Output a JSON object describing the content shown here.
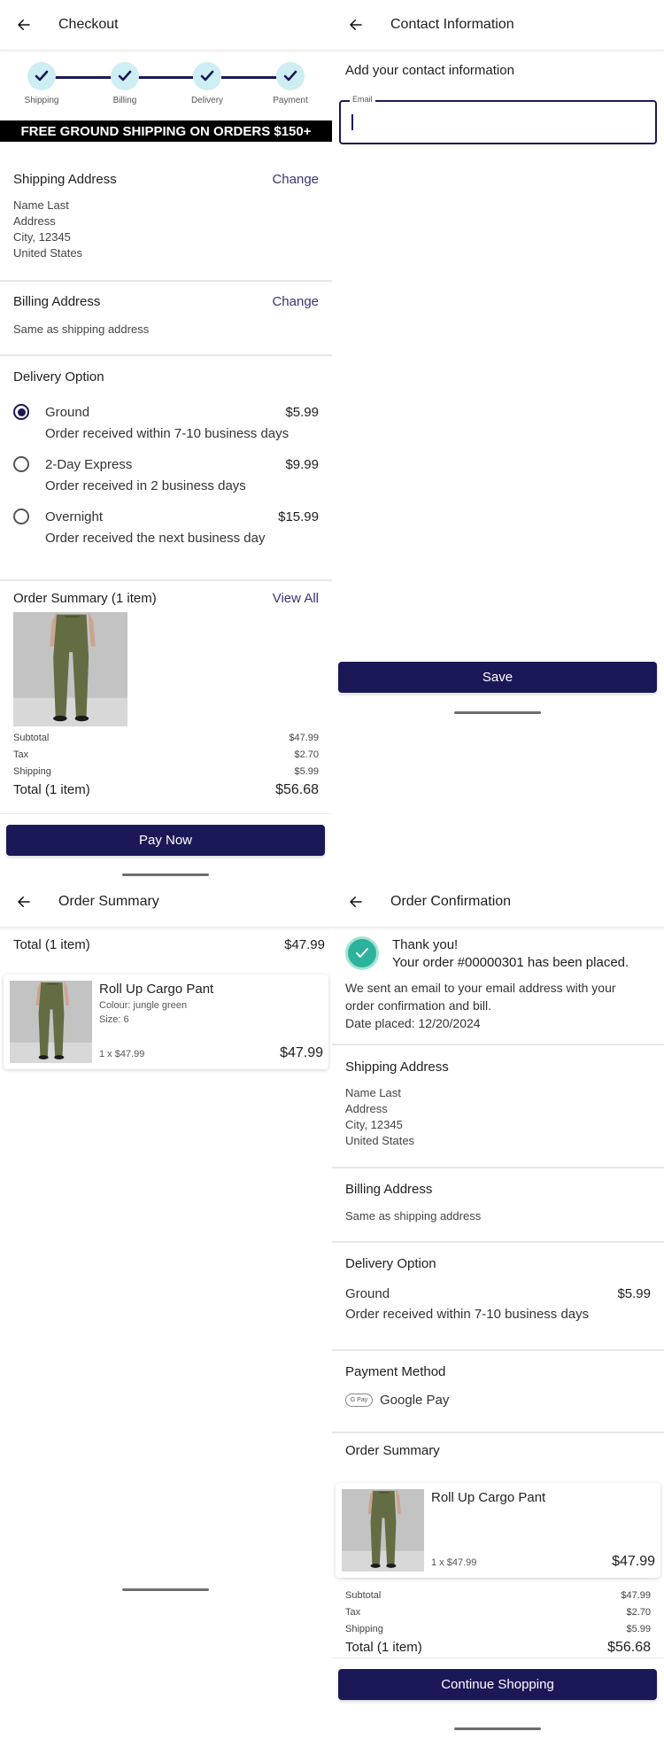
{
  "checkout": {
    "title": "Checkout",
    "steps": [
      {
        "label": "Shipping",
        "done": true
      },
      {
        "label": "Billing",
        "done": true
      },
      {
        "label": "Delivery",
        "done": true
      },
      {
        "label": "Payment",
        "done": true
      }
    ],
    "banner": "FREE GROUND SHIPPING ON ORDERS $150+",
    "shipping": {
      "title": "Shipping Address",
      "change": "Change",
      "lines": [
        "Name Last",
        "Address",
        "City, 12345",
        "United States"
      ]
    },
    "billing": {
      "title": "Billing Address",
      "change": "Change",
      "text": "Same as shipping address"
    },
    "delivery": {
      "title": "Delivery Option",
      "options": [
        {
          "label": "Ground",
          "price": "$5.99",
          "desc": "Order received within 7-10 business days",
          "selected": true
        },
        {
          "label": "2-Day Express",
          "price": "$9.99",
          "desc": "Order received in 2 business days",
          "selected": false
        },
        {
          "label": "Overnight",
          "price": "$15.99",
          "desc": "Order received the next business day",
          "selected": false
        }
      ]
    },
    "summary": {
      "title": "Order Summary (1 item)",
      "view_all": "View All",
      "rows": [
        {
          "label": "Subtotal",
          "value": "$47.99"
        },
        {
          "label": "Tax",
          "value": "$2.70"
        },
        {
          "label": "Shipping",
          "value": "$5.99"
        }
      ],
      "total_label": "Total (1 item)",
      "total_value": "$56.68"
    },
    "pay_button": "Pay Now"
  },
  "contact": {
    "title": "Contact Information",
    "heading": "Add your contact information",
    "email_label": "Email",
    "email_value": "",
    "save_button": "Save"
  },
  "order_summary": {
    "title": "Order Summary",
    "total_label": "Total (1 item)",
    "total_value": "$47.99",
    "item": {
      "name": "Roll Up Cargo Pant",
      "colour": "Colour: jungle green",
      "size": "Size: 6",
      "qty": "1 x $47.99",
      "price": "$47.99"
    }
  },
  "confirmation": {
    "title": "Order Confirmation",
    "thanks": "Thank you!",
    "placed": "Your order #00000301 has been placed.",
    "email_note": "We sent an email to your email address with your order confirmation and bill.",
    "date": "Date placed: 12/20/2024",
    "shipping": {
      "title": "Shipping Address",
      "lines": [
        "Name Last",
        "Address",
        "City, 12345",
        "United States"
      ]
    },
    "billing": {
      "title": "Billing Address",
      "text": "Same as shipping address"
    },
    "delivery": {
      "title": "Delivery Option",
      "label": "Ground",
      "price": "$5.99",
      "desc": "Order received within 7-10 business days"
    },
    "payment": {
      "title": "Payment Method",
      "badge": "G Pay",
      "method": "Google Pay"
    },
    "summary": {
      "title": "Order Summary",
      "item": {
        "name": "Roll Up Cargo Pant",
        "qty": "1 x $47.99",
        "price": "$47.99"
      },
      "rows": [
        {
          "label": "Subtotal",
          "value": "$47.99"
        },
        {
          "label": "Tax",
          "value": "$2.70"
        },
        {
          "label": "Shipping",
          "value": "$5.99"
        }
      ],
      "total_label": "Total (1 item)",
      "total_value": "$56.68"
    },
    "continue_button": "Continue Shopping"
  },
  "colors": {
    "primary": "#1b1857",
    "step_bg": "#cdeef3",
    "success": "#2bb39b",
    "banner_bg": "#000000"
  }
}
